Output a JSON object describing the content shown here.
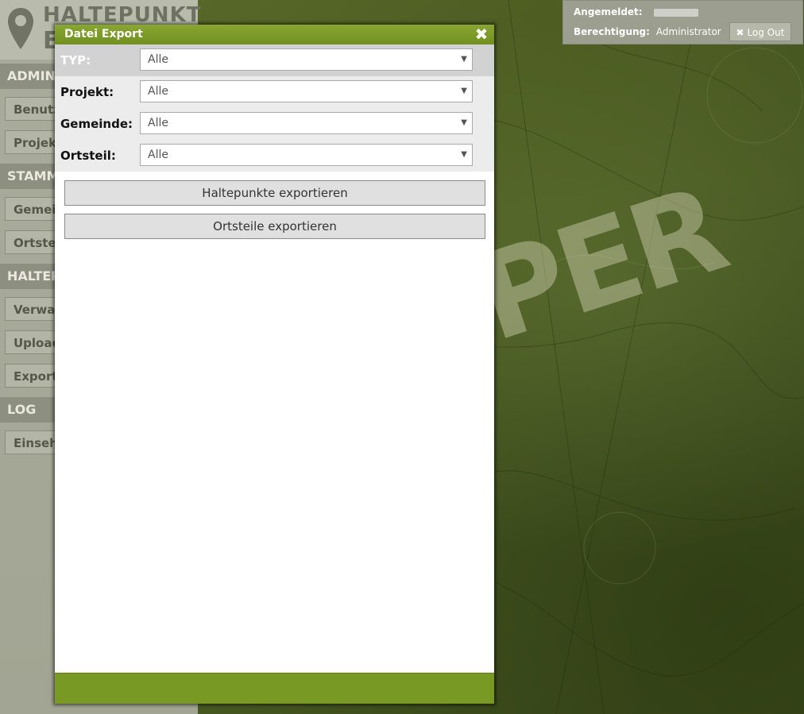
{
  "app": {
    "logo_title": "HALTEPUNKT",
    "logo_sub": "E"
  },
  "sidebar": {
    "sections": [
      {
        "label": "ADMINI",
        "items": [
          "Benutz",
          "Projekt"
        ]
      },
      {
        "label": "STAMM",
        "items": [
          "Gemein",
          "Ortstei"
        ]
      },
      {
        "label": "HALTEP",
        "items": [
          "Verwal",
          "Upload",
          "Export"
        ]
      },
      {
        "label": "LOG",
        "items": [
          "Einsehe"
        ]
      }
    ]
  },
  "user": {
    "logged_in_label": "Angemeldet:",
    "permission_label": "Berechtigung:",
    "permission_value": "Administrator",
    "logout_label": "Log Out",
    "logout_icon": "close-icon"
  },
  "dialog": {
    "title": "Datei Export",
    "close_icon": "close-icon",
    "fields": [
      {
        "label": "TYP:",
        "value": "Alle"
      },
      {
        "label": "Projekt:",
        "value": "Alle"
      },
      {
        "label": "Gemeinde:",
        "value": "Alle"
      },
      {
        "label": "Ortsteil:",
        "value": "Alle"
      }
    ],
    "buttons": {
      "export_stops": "Haltepunkte exportieren",
      "export_districts": "Ortsteile exportieren"
    }
  },
  "background": {
    "stamp_text": "PER"
  },
  "colors": {
    "accent_green": "#789a24",
    "header_green": "#7e9b28"
  }
}
